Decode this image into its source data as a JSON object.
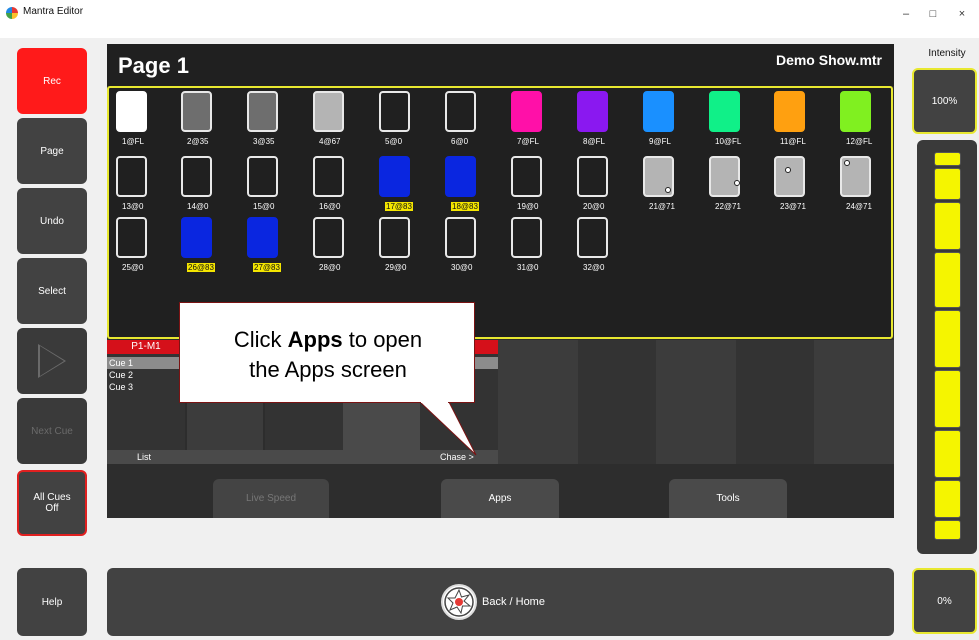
{
  "window": {
    "title": "Mantra Editor",
    "minimize": "–",
    "maximize": "□",
    "close": "×"
  },
  "left_buttons": {
    "rec": "Rec",
    "page": "Page",
    "undo": "Undo",
    "select": "Select",
    "next_cue": "Next Cue",
    "all_cues_off": "All Cues Off",
    "help": "Help"
  },
  "page": {
    "title": "Page 1",
    "show_name": "Demo Show.mtr"
  },
  "fixtures": [
    {
      "label": "1@FL",
      "color": "#ffffff"
    },
    {
      "label": "2@35",
      "color": "#6e6e6e"
    },
    {
      "label": "3@35",
      "color": "#6e6e6e"
    },
    {
      "label": "4@67",
      "color": "#b4b4b4"
    },
    {
      "label": "5@0",
      "color": ""
    },
    {
      "label": "6@0",
      "color": ""
    },
    {
      "label": "7@FL",
      "color": "#ff10a8"
    },
    {
      "label": "8@FL",
      "color": "#8a18f0"
    },
    {
      "label": "9@FL",
      "color": "#1a90ff"
    },
    {
      "label": "10@FL",
      "color": "#10f088"
    },
    {
      "label": "11@FL",
      "color": "#ffa010"
    },
    {
      "label": "12@FL",
      "color": "#80f020"
    },
    {
      "label": "13@0",
      "color": ""
    },
    {
      "label": "14@0",
      "color": ""
    },
    {
      "label": "15@0",
      "color": ""
    },
    {
      "label": "16@0",
      "color": ""
    },
    {
      "label": "17@83",
      "color": "#0a26e0",
      "highlight": true
    },
    {
      "label": "18@83",
      "color": "#0a26e0",
      "highlight": true
    },
    {
      "label": "19@0",
      "color": ""
    },
    {
      "label": "20@0",
      "color": ""
    },
    {
      "label": "21@71",
      "color": "#b4b4b4",
      "dot": "br"
    },
    {
      "label": "22@71",
      "color": "#b4b4b4",
      "dot": "mr"
    },
    {
      "label": "23@71",
      "color": "#b4b4b4",
      "dot": "tl"
    },
    {
      "label": "24@71",
      "color": "#b4b4b4",
      "dot": "tlc"
    },
    {
      "label": "25@0",
      "color": ""
    },
    {
      "label": "26@83",
      "color": "#0a26e0",
      "highlight": true
    },
    {
      "label": "27@83",
      "color": "#0a26e0",
      "highlight": true
    },
    {
      "label": "28@0",
      "color": ""
    },
    {
      "label": "29@0",
      "color": ""
    },
    {
      "label": "30@0",
      "color": ""
    },
    {
      "label": "31@0",
      "color": ""
    },
    {
      "label": "32@0",
      "color": ""
    }
  ],
  "cue_list": {
    "header": "P1-M1",
    "cues": [
      "Cue 1",
      "Cue 2",
      "Cue 3"
    ],
    "tab_list": "List",
    "tab_chase": "Chase >"
  },
  "main_buttons": {
    "live_speed": "Live Speed",
    "apps": "Apps",
    "tools": "Tools"
  },
  "callout": {
    "prefix": "Click ",
    "bold": "Apps",
    "line1_suffix": " to open",
    "line2": "the Apps screen"
  },
  "intensity": {
    "label": "Intensity",
    "top_value": "100%",
    "bottom_value": "0%",
    "level": 1.0
  },
  "bottom": {
    "back_home": "Back / Home"
  },
  "colors": {
    "accent_yellow": "#e8e830",
    "rec_red": "#ff1a1a",
    "cue_red": "#d5101a",
    "highlight": "#f5e600"
  }
}
